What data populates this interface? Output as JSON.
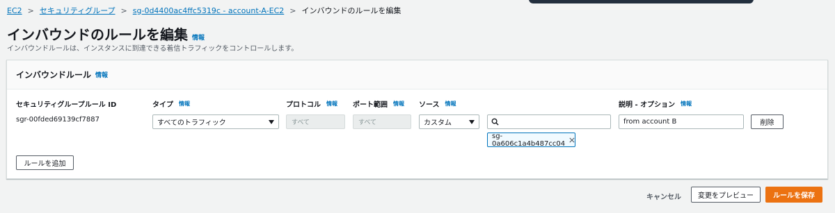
{
  "breadcrumb": {
    "items": [
      "EC2",
      "セキュリティグループ",
      "sg-0d4400ac4ffc5319c - account-A-EC2"
    ],
    "current": "インバウンドのルールを編集",
    "separator": ">"
  },
  "page": {
    "title": "インバウンドのルールを編集",
    "info": "情報",
    "description": "インバウンドルールは、インスタンスに到達できる着信トラフィックをコントロールします。"
  },
  "panel": {
    "title": "インバウンドルール",
    "info": "情報",
    "columns": {
      "rule_id": "セキュリティグループルール ID",
      "type": "タイプ",
      "protocol": "プロトコル",
      "port_range": "ポート範囲",
      "source": "ソース",
      "description": "説明 - オプション",
      "info": "情報"
    },
    "rule": {
      "id": "sgr-00fded69139cf7887",
      "type": "すべてのトラフィック",
      "protocol": "すべて",
      "port_range": "すべて",
      "source_type": "カスタム",
      "source_search_value": "",
      "source_token": "sg-0a606c1a4b487cc04",
      "description": "from account B",
      "delete_label": "削除"
    },
    "add_rule_label": "ルールを追加"
  },
  "footer": {
    "cancel_label": "キャンセル",
    "preview_label": "変更をプレビュー",
    "save_label": "ルールを保存"
  },
  "colors": {
    "link": "#0073bb",
    "primary": "#ec7211",
    "background": "#f2f3f3"
  },
  "icons": [
    "chevron-right-icon",
    "caret-down-icon",
    "search-icon",
    "close-icon"
  ]
}
